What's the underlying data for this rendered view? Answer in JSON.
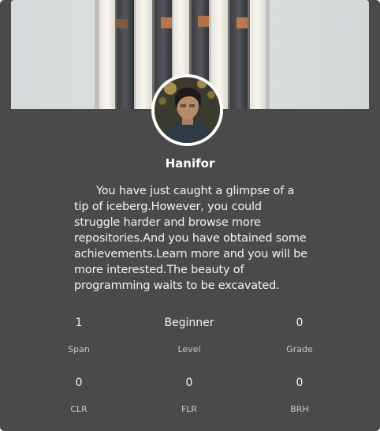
{
  "profile": {
    "name": "Hanifor",
    "bio": "You have just caught a glimpse of a tip of iceberg.However, you could struggle harder and browse more repositories.And you have obtained some achievements.Learn more and you will be more interested.The beauty of programming waits to be excavated.",
    "banner_image": "piano-keys-photo",
    "avatar_image": "user-avatar-photo"
  },
  "stats": [
    {
      "value": "1",
      "label": "Span"
    },
    {
      "value": "Beginner",
      "label": "Level"
    },
    {
      "value": "0",
      "label": "Grade"
    },
    {
      "value": "0",
      "label": "CLR"
    },
    {
      "value": "0",
      "label": "FLR"
    },
    {
      "value": "0",
      "label": "BRH"
    }
  ],
  "colors": {
    "card_background": "#4a4a4a",
    "text_primary": "#ffffff",
    "text_secondary": "#c8c8c8",
    "avatar_ring": "#ffffff"
  }
}
